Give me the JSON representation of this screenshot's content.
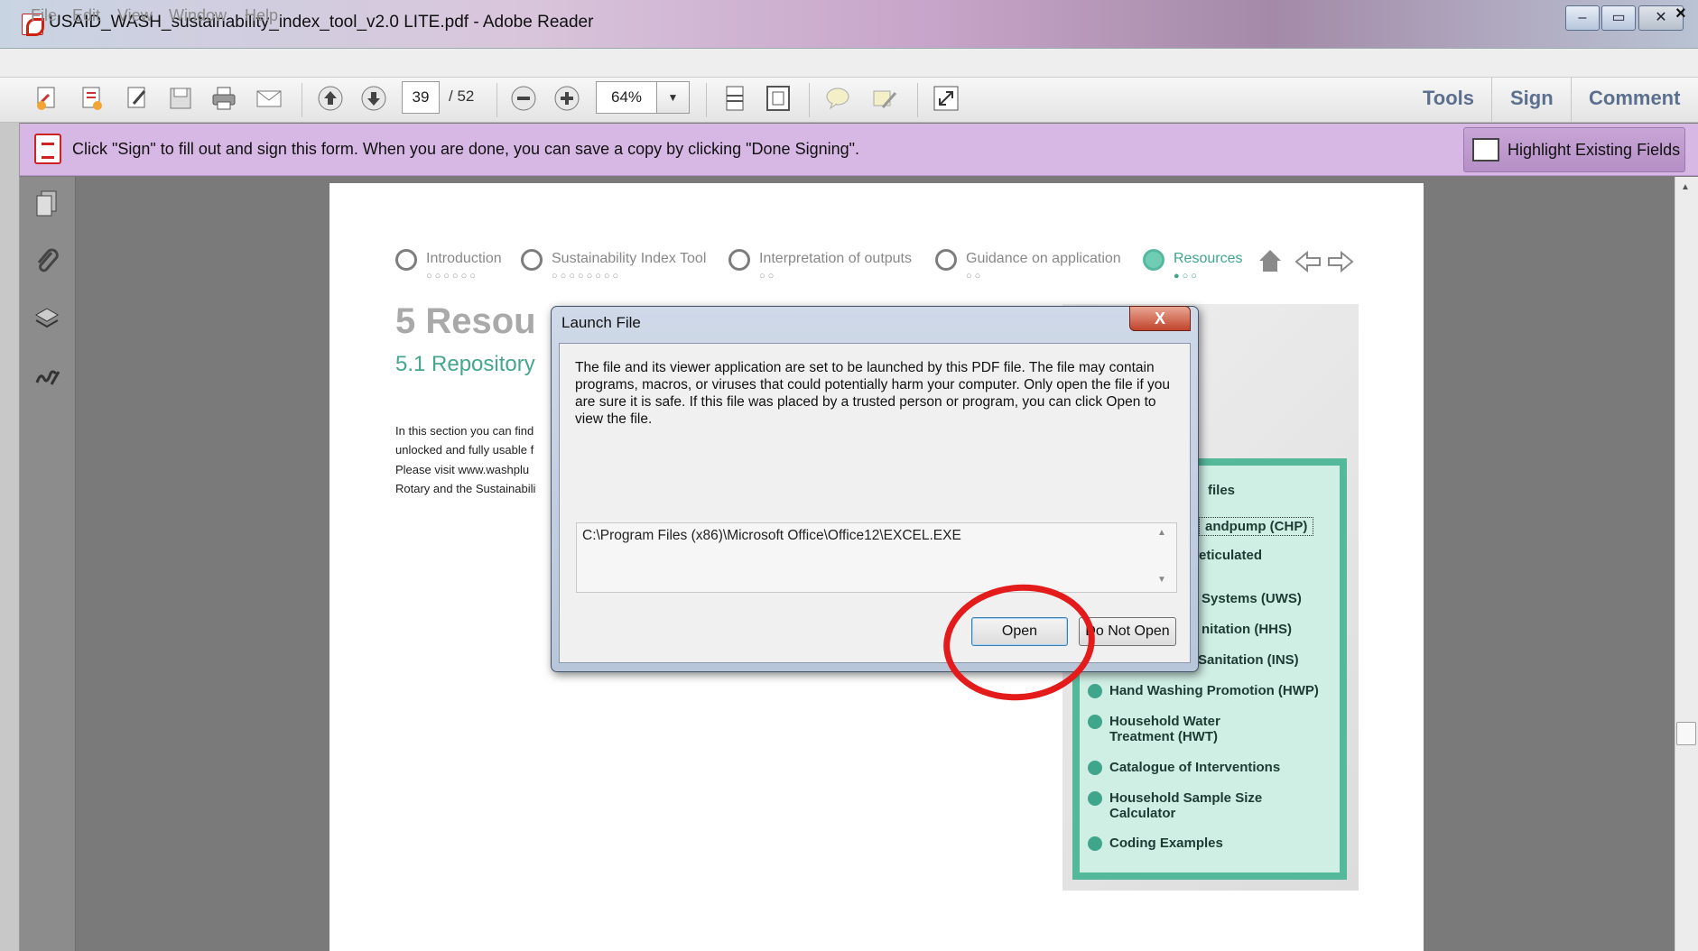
{
  "window": {
    "title": "USAID_WASH_sustainability_index_tool_v2.0 LITE.pdf - Adobe Reader",
    "min": "–",
    "max": "▭",
    "close": "✕"
  },
  "menu": {
    "items": [
      "File",
      "Edit",
      "View",
      "Window",
      "Help"
    ],
    "close_doc": "×"
  },
  "toolbar": {
    "page_current": "39",
    "page_total": "/ 52",
    "zoom": "64%",
    "zoom_dropdown": "▼",
    "right": {
      "tools": "Tools",
      "sign": "Sign",
      "comment": "Comment"
    }
  },
  "message_bar": {
    "text": "Click \"Sign\" to fill out and sign this form. When you are done, you can save a copy by clicking \"Done Signing\".",
    "button": "Highlight Existing Fields"
  },
  "document": {
    "steps": [
      {
        "label": "Introduction",
        "dots": "○○○○○○"
      },
      {
        "label": "Sustainability Index Tool",
        "dots": "○○○○○○○○"
      },
      {
        "label": "Interpretation of outputs",
        "dots": "○○"
      },
      {
        "label": "Guidance on application",
        "dots": "○○"
      },
      {
        "label": "Resources",
        "dots": "●○○"
      }
    ],
    "heading": "5  Resou",
    "subheading": "5.1   Repository",
    "body_lines": [
      "In this section you can find",
      "unlocked and fully usable f",
      "Please visit www.washplu",
      "Rotary and the Sustainabili"
    ],
    "panel_title": "files",
    "panel_items": [
      "andpump (CHP)",
      "eticulated",
      "Systems (UWS)",
      "nitation (HHS)",
      "Sanitation (INS)",
      "Hand Washing Promotion (HWP)",
      "Household Water",
      "Treatment (HWT)",
      "Catalogue of Interventions",
      "Household Sample Size",
      "Calculator",
      "Coding Examples"
    ]
  },
  "dialog": {
    "title": "Launch File",
    "close": "X",
    "message": "The file and its viewer application are set to be launched by this PDF file. The file may contain programs, macros, or viruses that could potentially harm your computer. Only open the file if you are sure it is safe. If this file was placed by a trusted person or program, you can click Open to view the file.",
    "path": "C:\\Program Files (x86)\\Microsoft Office\\Office12\\EXCEL.EXE",
    "scroll_up": "▲",
    "scroll_down": "▼",
    "open_button": "Open",
    "cancel_button": "Do Not Open"
  },
  "colors": {
    "accent_green": "#54b89b",
    "message_bar": "#d7b7e4",
    "annotation_red": "#e41b1b"
  },
  "icons": [
    "create-pdf-icon",
    "export-icon",
    "edit-icon",
    "save-icon",
    "print-icon",
    "email-icon",
    "prev-page-icon",
    "next-page-icon",
    "zoom-out-icon",
    "zoom-in-icon",
    "scroll-mode-icon",
    "fit-page-icon",
    "comment-icon",
    "highlight-icon",
    "fullscreen-icon",
    "pages-icon",
    "attachment-icon",
    "layers-icon",
    "signature-icon",
    "home-icon",
    "back-arrow-icon",
    "forward-arrow-icon"
  ]
}
